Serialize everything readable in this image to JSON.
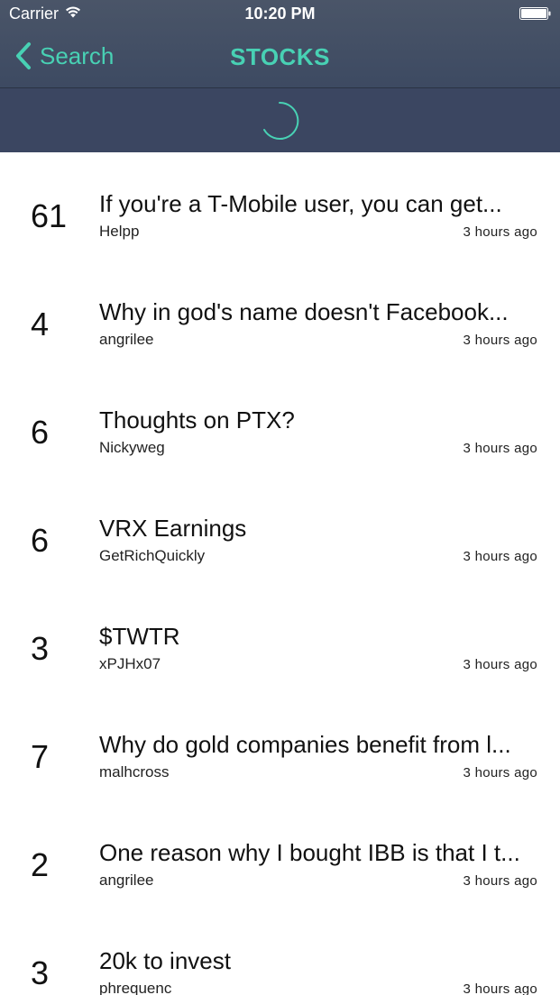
{
  "status_bar": {
    "carrier": "Carrier",
    "time": "10:20 PM",
    "wifi_icon": "wifi-icon",
    "battery_icon": "battery-icon"
  },
  "nav": {
    "back_label": "Search",
    "back_icon": "chevron-left-icon",
    "title": "STOCKS",
    "accent_color": "#48d1b4"
  },
  "refresh": {
    "indicator": "spinner-icon"
  },
  "posts": [
    {
      "score": "61",
      "title": "If you're a T-Mobile user, you can get...",
      "author": "Helpp",
      "time": "3 hours ago"
    },
    {
      "score": "4",
      "title": "Why in god's name doesn't Facebook...",
      "author": "angrilee",
      "time": "3 hours ago"
    },
    {
      "score": "6",
      "title": "Thoughts on PTX?",
      "author": "Nickyweg",
      "time": "3 hours ago"
    },
    {
      "score": "6",
      "title": "VRX Earnings",
      "author": "GetRichQuickly",
      "time": "3 hours ago"
    },
    {
      "score": "3",
      "title": "$TWTR",
      "author": "xPJHx07",
      "time": "3 hours ago"
    },
    {
      "score": "7",
      "title": "Why do gold companies benefit from l...",
      "author": "malhcross",
      "time": "3 hours ago"
    },
    {
      "score": "2",
      "title": "One reason why I bought IBB is that I t...",
      "author": "angrilee",
      "time": "3 hours ago"
    },
    {
      "score": "3",
      "title": "20k to invest",
      "author": "phrequenc",
      "time": "3 hours ago"
    }
  ]
}
